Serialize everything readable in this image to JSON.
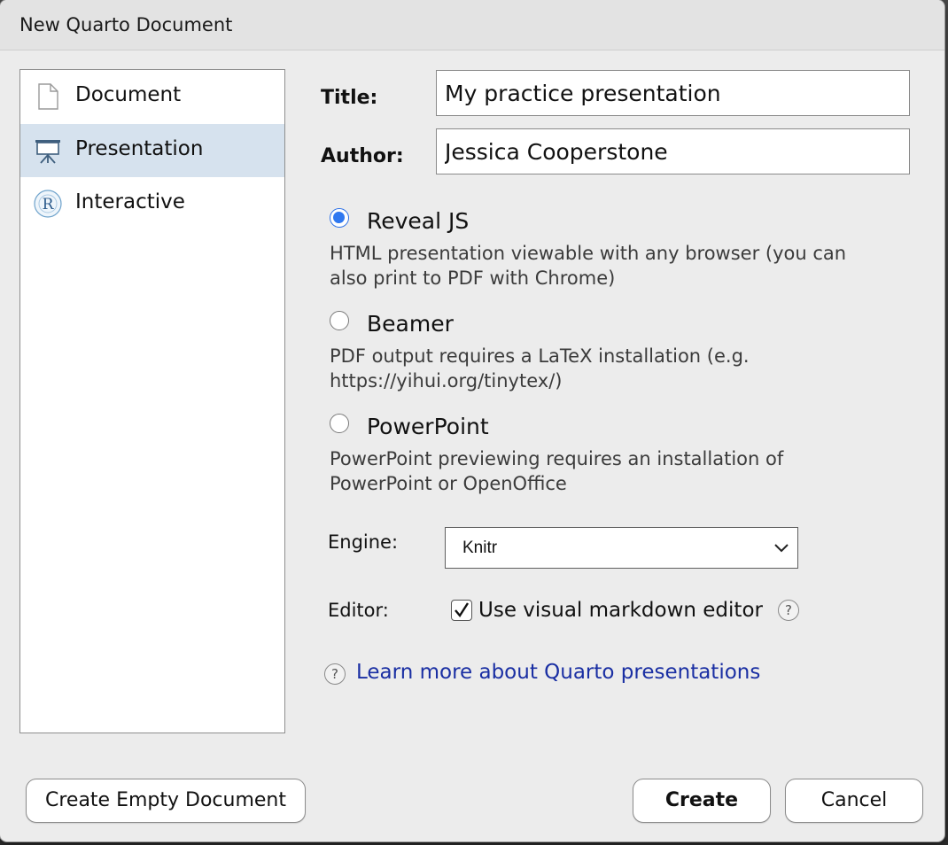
{
  "window": {
    "title": "New Quarto Document"
  },
  "types": [
    {
      "label": "Document",
      "icon": "document-icon",
      "selected": false
    },
    {
      "label": "Presentation",
      "icon": "presentation-easel-icon",
      "selected": true
    },
    {
      "label": "Interactive",
      "icon": "r-logo-icon",
      "selected": false
    }
  ],
  "form": {
    "title_label": "Title:",
    "title_value": "My practice presentation",
    "author_label": "Author:",
    "author_value": "Jessica Cooperstone"
  },
  "formats": [
    {
      "label": "Reveal JS",
      "checked": true,
      "desc_line1": "HTML presentation viewable with any browser (you can",
      "desc_line2": "also print to PDF with Chrome)"
    },
    {
      "label": "Beamer",
      "checked": false,
      "desc_line1": "PDF output requires a LaTeX installation (e.g.",
      "desc_line2": "https://yihui.org/tinytex/)"
    },
    {
      "label": "PowerPoint",
      "checked": false,
      "desc_line1": "PowerPoint previewing requires an installation of",
      "desc_line2": "PowerPoint or OpenOffice"
    }
  ],
  "engine": {
    "label": "Engine:",
    "selected": "Knitr"
  },
  "editor": {
    "label": "Editor:",
    "checkbox_label": "Use visual markdown editor",
    "checked": true
  },
  "help_glyph": "?",
  "learn_more": "Learn more about Quarto presentations",
  "buttons": {
    "create_empty": "Create Empty Document",
    "create": "Create",
    "cancel": "Cancel"
  },
  "colors": {
    "selection": "#d6e2ee",
    "radio_accent": "#2f78f0",
    "link": "#1a2fa3"
  }
}
